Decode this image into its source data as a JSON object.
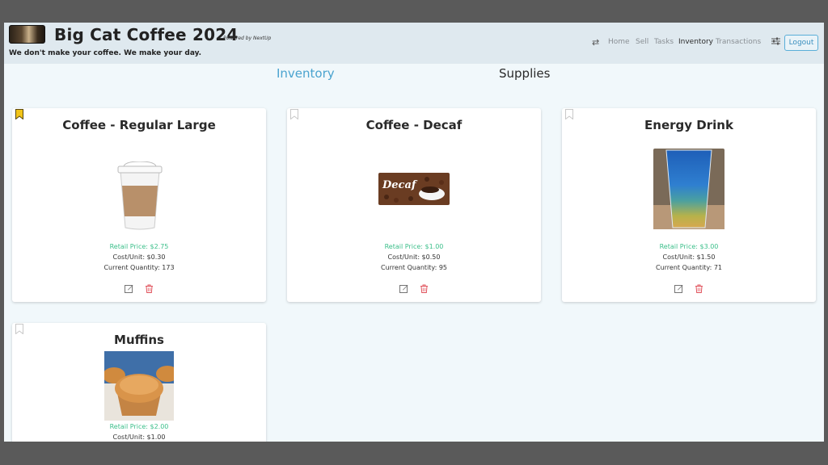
{
  "header": {
    "title": "Big Cat Coffee 2024",
    "powered_by": "Powered by NextUp",
    "tagline": "We don't make your coffee. We make your day.",
    "nav": [
      "Home",
      "Sell",
      "Tasks",
      "Inventory",
      "Transactions"
    ],
    "active_nav": "Inventory",
    "logout_label": "Logout"
  },
  "tabs": {
    "inventory": "Inventory",
    "supplies": "Supplies"
  },
  "colors": {
    "accent": "#4aa3cf",
    "retail_price": "#3bbf8a",
    "delete": "#e0505a",
    "bookmark_active": "#f2c417"
  },
  "products": [
    {
      "name": "Coffee - Regular Large",
      "retail": "Retail Price: $2.75",
      "cost": "Cost/Unit: $0.30",
      "quantity": "Current Quantity: 173",
      "bookmarked": true
    },
    {
      "name": "Coffee - Decaf",
      "retail": "Retail Price: $1.00",
      "cost": "Cost/Unit: $0.50",
      "quantity": "Current Quantity: 95",
      "image_text": "Decaf",
      "bookmarked": false
    },
    {
      "name": "Energy Drink",
      "retail": "Retail Price: $3.00",
      "cost": "Cost/Unit: $1.50",
      "quantity": "Current Quantity: 71",
      "bookmarked": false
    },
    {
      "name": "Muffins",
      "retail": "Retail Price: $2.00",
      "cost": "Cost/Unit: $1.00",
      "bookmarked": false
    }
  ]
}
